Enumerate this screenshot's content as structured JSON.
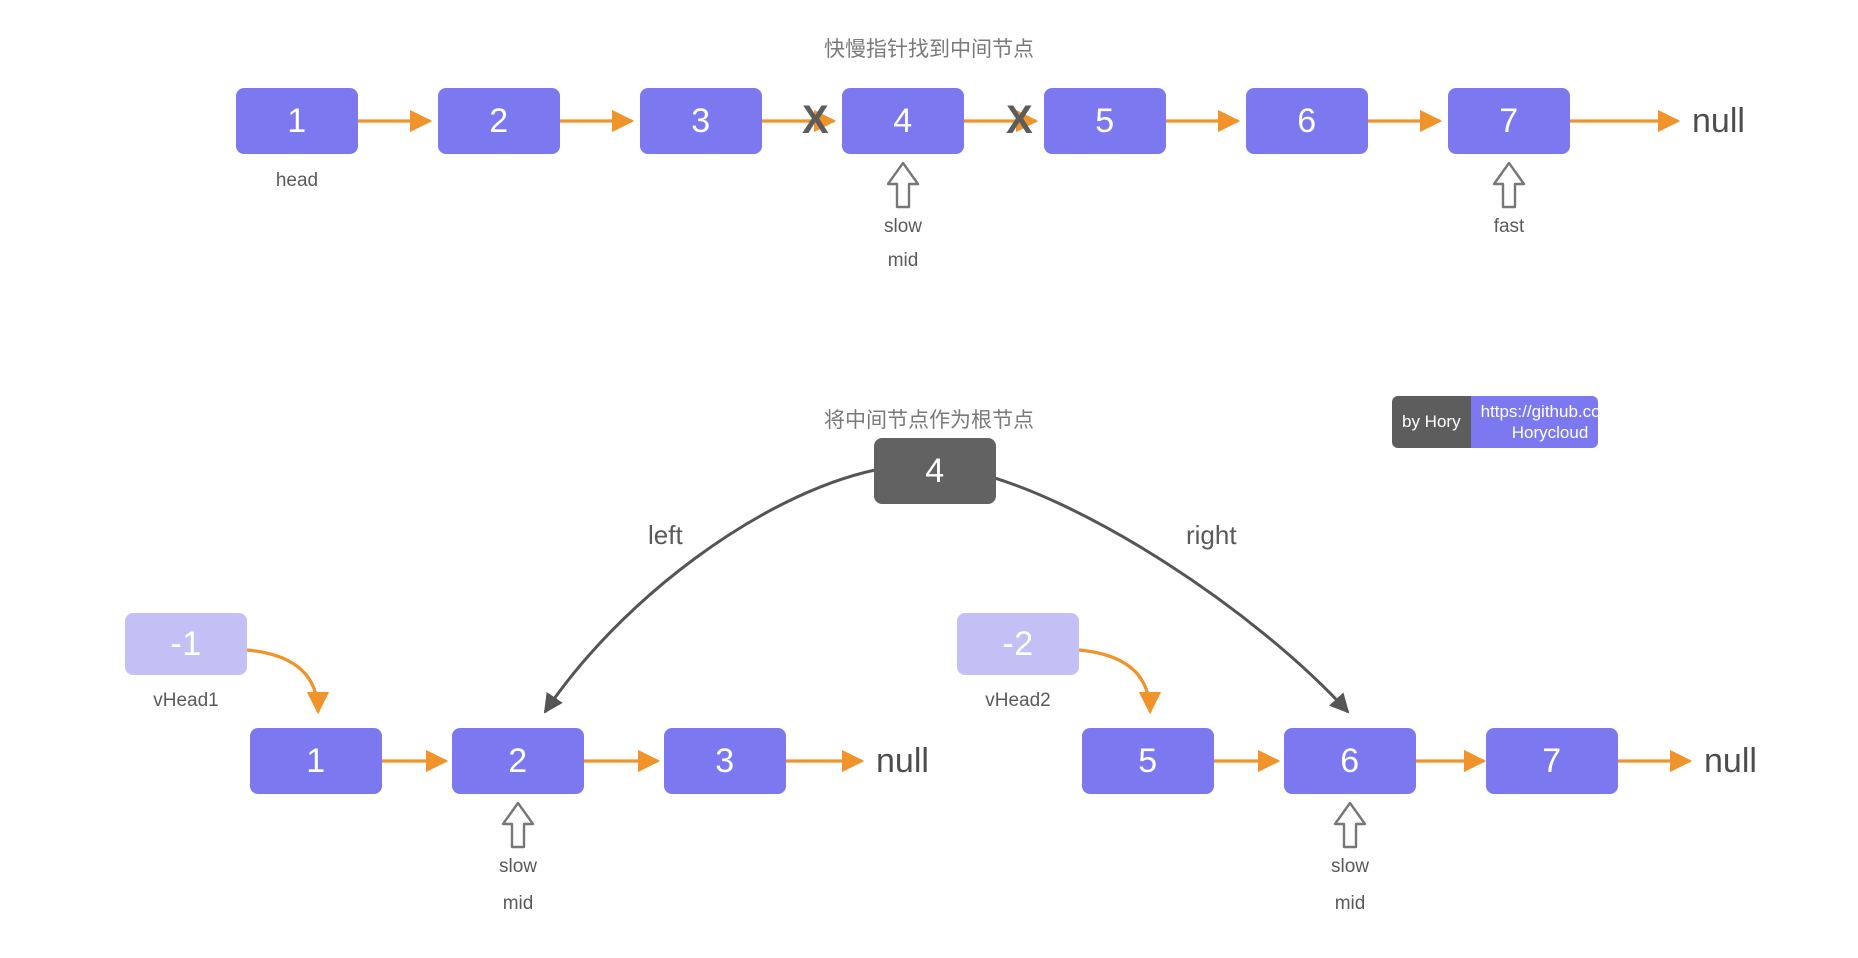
{
  "diagram": {
    "background_color": "#ffffff",
    "node_color": "#7b78f0",
    "vhead_color": "#c2c0f5",
    "root_color": "#626262",
    "arrow_color": "#f0932b",
    "curve_color": "#555555",
    "text_color": "#5a5a5a"
  },
  "section1": {
    "title": "快慢指针找到中间节点",
    "nodes": [
      {
        "value": "1"
      },
      {
        "value": "2"
      },
      {
        "value": "3"
      },
      {
        "value": "4"
      },
      {
        "value": "5"
      },
      {
        "value": "6"
      },
      {
        "value": "7"
      }
    ],
    "null_label": "null",
    "head_label": "head",
    "cut_marks": [
      "X",
      "X"
    ],
    "pointers": [
      {
        "name": "slow",
        "extra": "mid",
        "target_value": "4"
      },
      {
        "name": "fast",
        "extra": "",
        "target_value": "7"
      }
    ]
  },
  "section2": {
    "title": "将中间节点作为根节点",
    "root": {
      "value": "4"
    },
    "edge_labels": {
      "left": "left",
      "right": "right"
    },
    "left_list": {
      "vhead": {
        "value": "-1",
        "label": "vHead1"
      },
      "nodes": [
        {
          "value": "1"
        },
        {
          "value": "2"
        },
        {
          "value": "3"
        }
      ],
      "null_label": "null",
      "pointer": {
        "name": "slow",
        "extra": "mid",
        "target_value": "2"
      }
    },
    "right_list": {
      "vhead": {
        "value": "-2",
        "label": "vHead2"
      },
      "nodes": [
        {
          "value": "5"
        },
        {
          "value": "6"
        },
        {
          "value": "7"
        }
      ],
      "null_label": "null",
      "pointer": {
        "name": "slow",
        "extra": "mid",
        "target_value": "6"
      }
    }
  },
  "watermark": {
    "author": "by Hory",
    "url": "https://github.com/\nHorycloud"
  }
}
